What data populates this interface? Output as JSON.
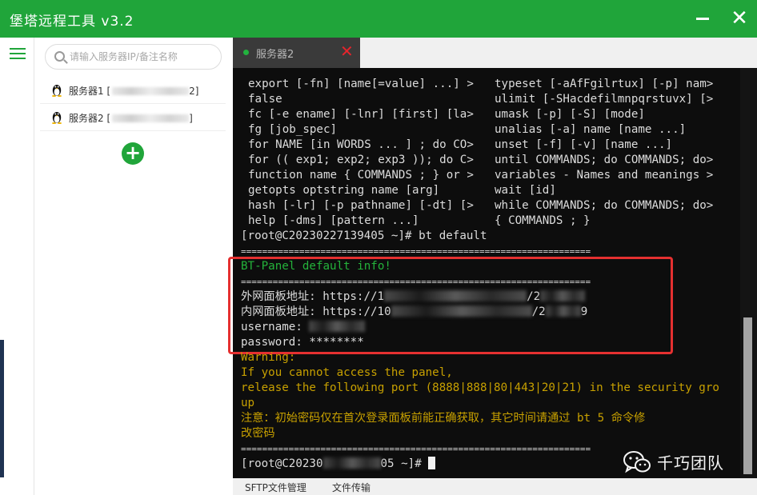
{
  "app": {
    "title": "堡塔远程工具 v3.2",
    "accent": "#20a53a",
    "window_controls": {
      "minimize_icon": "minus-icon",
      "close_icon": "close-icon",
      "close_symbol": "✕"
    }
  },
  "sidebar": {
    "menu_icon": "hamburger-menu-icon",
    "search": {
      "placeholder": "请输入服务器IP/备注名称",
      "value": ""
    },
    "servers": [
      {
        "os_icon": "linux-tux-icon",
        "label": "服务器1 [",
        "ip_suffix": "2]"
      },
      {
        "os_icon": "linux-tux-icon",
        "label": "服务器2 [",
        "ip_suffix": "]"
      }
    ],
    "add_button": "+"
  },
  "tabs": [
    {
      "label": "服务器2",
      "status_color": "#22b23e",
      "close_symbol": "✕",
      "close_color": "#e6242c"
    }
  ],
  "terminal": {
    "help_left": [
      "export [-fn] [name[=value] ...] >",
      "false",
      "fc [-e ename] [-lnr] [first] [la>",
      "fg [job_spec]",
      "for NAME [in WORDS ... ] ; do CO>",
      "for (( exp1; exp2; exp3 )); do C>",
      "function name { COMMANDS ; } or >",
      "getopts optstring name [arg]",
      "hash [-lr] [-p pathname] [-dt] [>",
      "help [-dms] [pattern ...]"
    ],
    "help_right": [
      "typeset [-aAfFgilrtux] [-p] nam>",
      "ulimit [-SHacdefilmnpqrstuvx] [>",
      "umask [-p] [-S] [mode]",
      "unalias [-a] name [name ...]",
      "unset [-f] [-v] [name ...]",
      "until COMMANDS; do COMMANDS; do>",
      "variables - Names and meanings >",
      "wait [id]",
      "while COMMANDS; do COMMANDS; do>",
      "{ COMMANDS ; }"
    ],
    "prompt_cmd": "[root@C20230227139405 ~]# bt default",
    "separator": "==================================================================",
    "info_title": "BT-Panel default info!",
    "ext_label": "外网面板地址: https://1",
    "ext_tail": "/2",
    "int_label": "内网面板地址: https://10",
    "int_tail": "/2",
    "int_end": "9",
    "username_label": "username: ",
    "password_line": "password: ********",
    "warning": "Warning:",
    "warn1": "If you cannot access the panel,",
    "warn2": "release the following port (8888|888|80|443|20|21) in the security gro",
    "warn3": "up",
    "notice1": "注意：初始密码仅在首次登录面板前能正确获取，其它时间请通过 bt 5 命令修",
    "notice2": "改密码",
    "prompt_start": "[root@C20230",
    "prompt_end": "05 ~]# ",
    "colors": {
      "text": "#dcdcdc",
      "warning": "#c7a000",
      "success": "#24b33b",
      "highlight_box": "#e53030"
    }
  },
  "watermark": {
    "icon": "wechat-icon",
    "text": "千巧团队"
  },
  "bottom_tabs": [
    "SFTP文件管理",
    "文件传输"
  ]
}
